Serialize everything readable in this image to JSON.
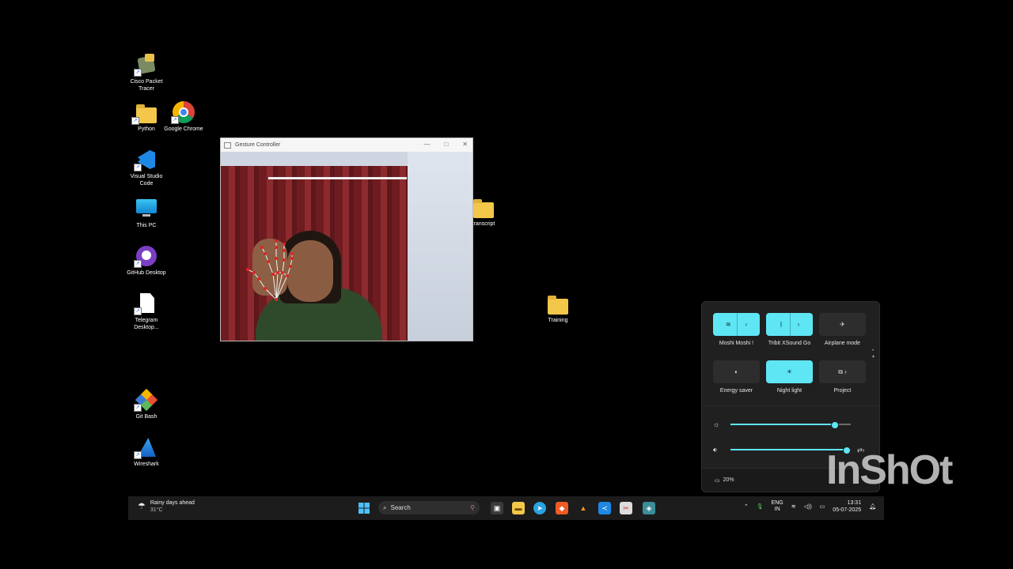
{
  "desktop": {
    "icons": [
      {
        "label": "Cisco Packet Tracer"
      },
      {
        "label": "Python"
      },
      {
        "label": "Google Chrome"
      },
      {
        "label": "Visual Studio Code"
      },
      {
        "label": "This PC"
      },
      {
        "label": "GitHub Desktop"
      },
      {
        "label": "Telegram Desktop..."
      },
      {
        "label": "Git Bash"
      },
      {
        "label": "Wireshark"
      },
      {
        "label": "transcript"
      },
      {
        "label": "Training"
      }
    ]
  },
  "gesture_window": {
    "title": "Gesture Controller",
    "minimize": "—",
    "maximize": "□",
    "close": "✕"
  },
  "quick_settings": {
    "tiles_row1": [
      {
        "label": "Moshi Moshi !",
        "icon": "wifi-icon",
        "on": true
      },
      {
        "label": "Tribit XSound Go",
        "icon": "bluetooth-icon",
        "on": true
      },
      {
        "label": "Airplane mode",
        "icon": "airplane-icon",
        "on": false
      }
    ],
    "tiles_row2": [
      {
        "label": "Energy saver",
        "icon": "energy-saver-icon",
        "on": false
      },
      {
        "label": "Night light",
        "icon": "night-light-icon",
        "on": true
      },
      {
        "label": "Project",
        "icon": "project-icon",
        "on": false
      }
    ],
    "brightness": 0.86,
    "volume": 0.96,
    "battery": "20%",
    "accent": "#5ee6f5"
  },
  "taskbar": {
    "weather_text": "Rainy days ahead",
    "weather_temp": "31°C",
    "search_placeholder": "Search",
    "lang_line1": "ENG",
    "lang_line2": "IN",
    "time": "13:31",
    "date": "05-07-2025"
  },
  "watermark": "InShOt"
}
